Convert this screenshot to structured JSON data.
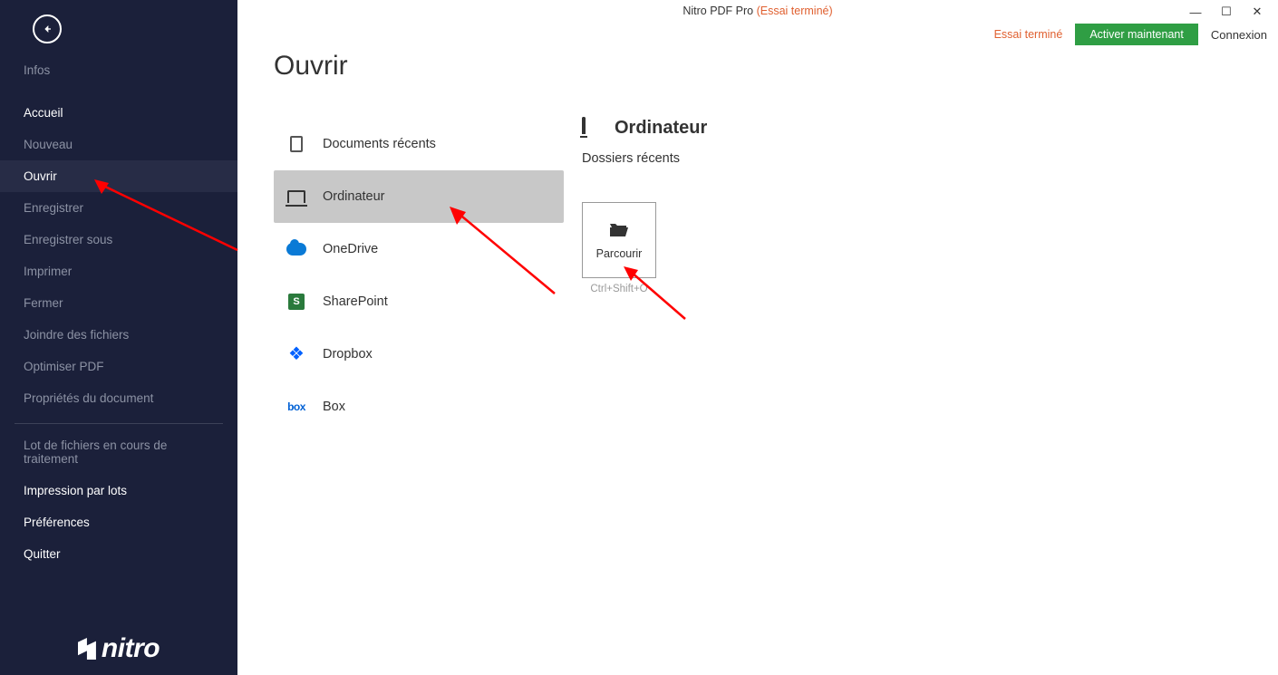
{
  "titlebar": {
    "app_name": "Nitro PDF Pro",
    "trial_suffix": "(Essai terminé)"
  },
  "header": {
    "trial_text": "Essai terminé",
    "activate_label": "Activer maintenant",
    "login_label": "Connexion"
  },
  "sidebar": {
    "items": [
      {
        "label": "Infos",
        "bright": false
      },
      {
        "label": "Accueil",
        "bright": true
      },
      {
        "label": "Nouveau",
        "bright": false
      },
      {
        "label": "Ouvrir",
        "bright": true,
        "selected": true
      },
      {
        "label": "Enregistrer",
        "bright": false
      },
      {
        "label": "Enregistrer sous",
        "bright": false
      },
      {
        "label": "Imprimer",
        "bright": false
      },
      {
        "label": "Fermer",
        "bright": false
      },
      {
        "label": "Joindre des fichiers",
        "bright": false
      },
      {
        "label": "Optimiser PDF",
        "bright": false
      },
      {
        "label": "Propriétés du document",
        "bright": false
      }
    ],
    "items2": [
      {
        "label": "Lot de fichiers en cours de traitement",
        "bright": false
      },
      {
        "label": "Impression par lots",
        "bright": true
      },
      {
        "label": "Préférences",
        "bright": true
      },
      {
        "label": "Quitter",
        "bright": true
      }
    ],
    "logo_text": "nitro"
  },
  "page": {
    "title": "Ouvrir"
  },
  "sources": [
    {
      "key": "recent",
      "label": "Documents récents"
    },
    {
      "key": "computer",
      "label": "Ordinateur",
      "selected": true
    },
    {
      "key": "onedrive",
      "label": "OneDrive"
    },
    {
      "key": "sharepoint",
      "label": "SharePoint"
    },
    {
      "key": "dropbox",
      "label": "Dropbox"
    },
    {
      "key": "box",
      "label": "Box"
    }
  ],
  "detail": {
    "heading": "Ordinateur",
    "subheading": "Dossiers récents",
    "browse_label": "Parcourir",
    "browse_shortcut": "Ctrl+Shift+O"
  }
}
